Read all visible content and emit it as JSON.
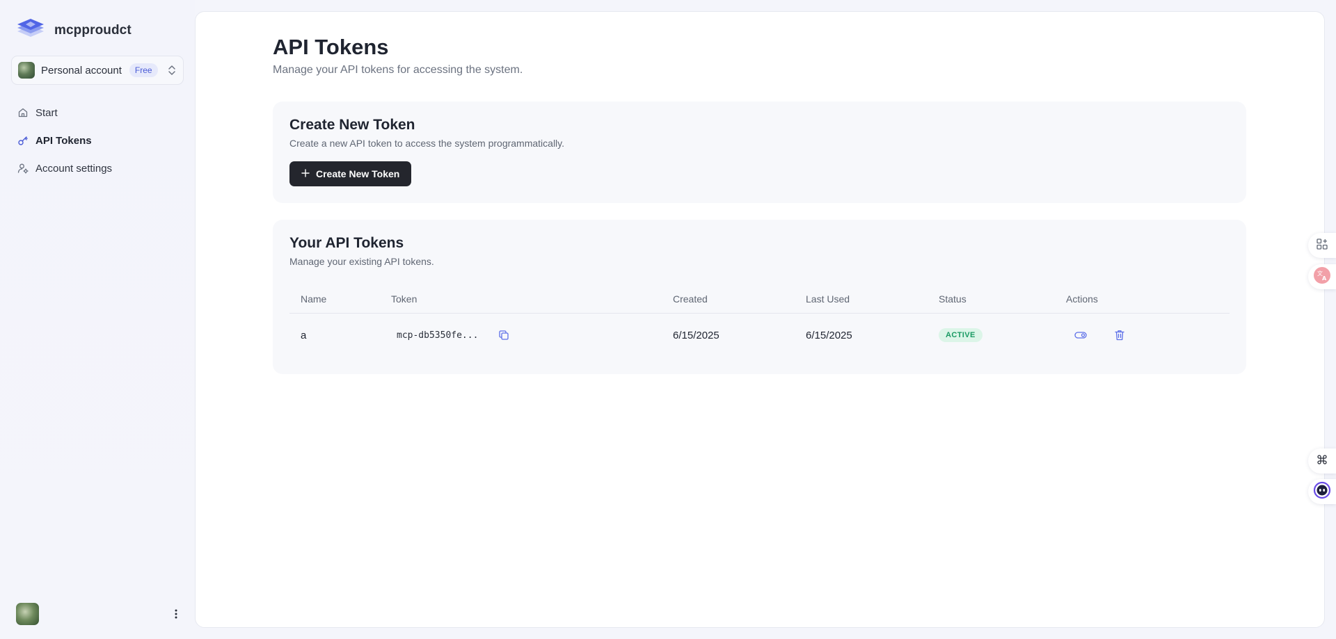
{
  "brand": {
    "name": "mcpproudct"
  },
  "account": {
    "name": "Personal account",
    "plan": "Free"
  },
  "nav": {
    "items": [
      {
        "label": "Start",
        "icon": "home-icon",
        "active": false
      },
      {
        "label": "API Tokens",
        "icon": "key-icon",
        "active": true
      },
      {
        "label": "Account settings",
        "icon": "user-gear-icon",
        "active": false
      }
    ]
  },
  "page": {
    "title": "API Tokens",
    "subtitle": "Manage your API tokens for accessing the system."
  },
  "create_card": {
    "title": "Create New Token",
    "description": "Create a new API token to access the system programmatically.",
    "button_label": "Create New Token"
  },
  "tokens_card": {
    "title": "Your API Tokens",
    "description": "Manage your existing API tokens.",
    "columns": [
      "Name",
      "Token",
      "Created",
      "Last Used",
      "Status",
      "Actions"
    ],
    "rows": [
      {
        "name": "a",
        "token": "mcp-db5350fe...",
        "created": "6/15/2025",
        "last_used": "6/15/2025",
        "status": "ACTIVE"
      }
    ]
  },
  "colors": {
    "accent": "#4a5bd6",
    "primary_button": "#24262d",
    "status_active_text": "#1a9a63",
    "status_active_bg": "#dcf5e8",
    "icon_blue": "#5b6ee8"
  }
}
